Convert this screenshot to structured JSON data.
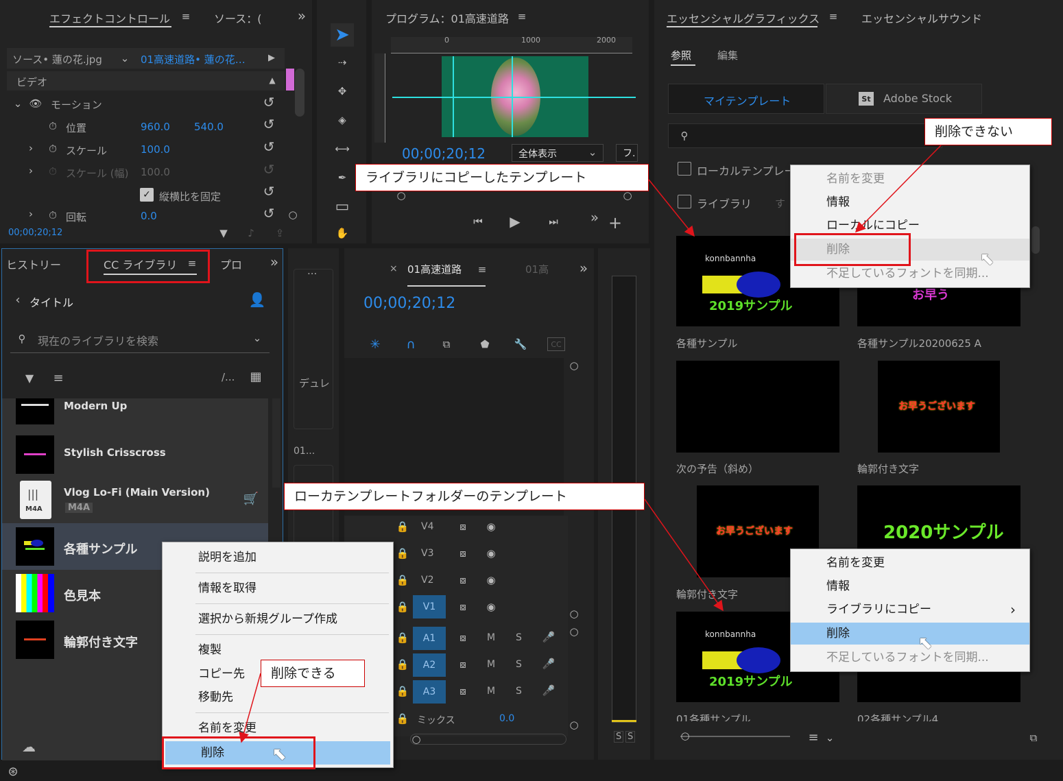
{
  "effect_controls": {
    "tab": "エフェクトコントロール",
    "tab2": "ソース：(",
    "source": "ソース• 蓮の花.jpg",
    "clip": "01高速道路• 蓮の花…",
    "section": "ビデオ",
    "motion": "モーション",
    "position_label": "位置",
    "pos_x": "960.0",
    "pos_y": "540.0",
    "scale_label": "スケール",
    "scale_val": "100.0",
    "scale_w_label": "スケール (幅)",
    "scale_w_val": "100.0",
    "aspect": "縦横比を固定",
    "rotation_label": "回転",
    "rotation_val": "0.0",
    "timecode": "00;00;20;12"
  },
  "program": {
    "title": "プログラム：01高速道路",
    "ruler": [
      "0",
      "1000",
      "2000"
    ],
    "ruler_v": "0",
    "timecode": "00;00;20;12",
    "fit": "全体表示",
    "quality": "フ."
  },
  "essential": {
    "tab1": "エッセンシャルグラフィックス",
    "tab2": "エッセンシャルサウンド",
    "sub1": "参照",
    "sub2": "編集",
    "btn1": "マイテンプレート",
    "btn2": "Adobe Stock",
    "st": "St",
    "local_chk": "ローカルテンプレー",
    "lib_chk": "ライブラリ",
    "lib_extra": "す",
    "templates": [
      {
        "label": "各種サンプル",
        "t1": "konnbannha",
        "t2": "2019サンプル"
      },
      {
        "label": "各種サンプル20200625 A",
        "t1": "",
        "t2": "お早う"
      },
      {
        "label": "次の予告（斜め）",
        "t1": "",
        "t2": ""
      },
      {
        "label": "輪郭付き文字",
        "t1": "",
        "t2": "お早うございます"
      },
      {
        "label": "輪郭付き文字",
        "t1": "",
        "t2": "お早うございます"
      },
      {
        "label": "",
        "t1": "",
        "t2": "2020サンプル"
      },
      {
        "label": "01各種サンプル",
        "t1": "konnbannha",
        "t2": "2019サンプル"
      },
      {
        "label": "02各種サンプル4",
        "t1": "",
        "t2": ""
      }
    ]
  },
  "cc_library": {
    "tab1": "ヒストリー",
    "tab2": "CC ライブラリ",
    "tab3": "プロ",
    "back": "タイトル",
    "search": "現在のライブラリを検索",
    "sort_label": "/...",
    "items": [
      {
        "name": "Modern Up"
      },
      {
        "name": "Stylish Crisscross"
      },
      {
        "name": "Vlog Lo-Fi (Main Version)",
        "badge": "M4A",
        "thumb": "M4A"
      },
      {
        "name": "各種サンプル"
      },
      {
        "name": "色見本"
      },
      {
        "name": "輪郭付き文字"
      }
    ]
  },
  "middle": {
    "dots": "...",
    "dur": "デュレ",
    "num": "01..."
  },
  "timeline": {
    "close": "×",
    "tab": "01高速道路",
    "tab2": "01高",
    "timecode": "00;00;20;12",
    "tracks_v": [
      "V4",
      "V3",
      "V2",
      "V1"
    ],
    "tracks_a": [
      "A1",
      "A2",
      "A3"
    ],
    "m": "M",
    "s": "S",
    "mix": "ミックス",
    "mix_val": "0.0"
  },
  "meter": {
    "s1": "S",
    "s2": "S"
  },
  "menu_lib": [
    "説明を追加",
    "情報を取得",
    "選択から新規グループ作成",
    "複製",
    "コピー先",
    "移動先",
    "名前を変更",
    "削除"
  ],
  "menu_top": [
    "名前を変更",
    "情報",
    "ローカルにコピー",
    "削除",
    "不足しているフォントを同期..."
  ],
  "menu_bottom": [
    "名前を変更",
    "情報",
    "ライブラリにコピー",
    "削除",
    "不足しているフォントを同期..."
  ],
  "menu_bottom_arrow": "›",
  "callouts": {
    "cannot": "削除できない",
    "library": "ライブラリにコピーしたテンプレート",
    "local": "ローカテンプレートフォルダーのテンプレート",
    "can": "削除できる"
  }
}
